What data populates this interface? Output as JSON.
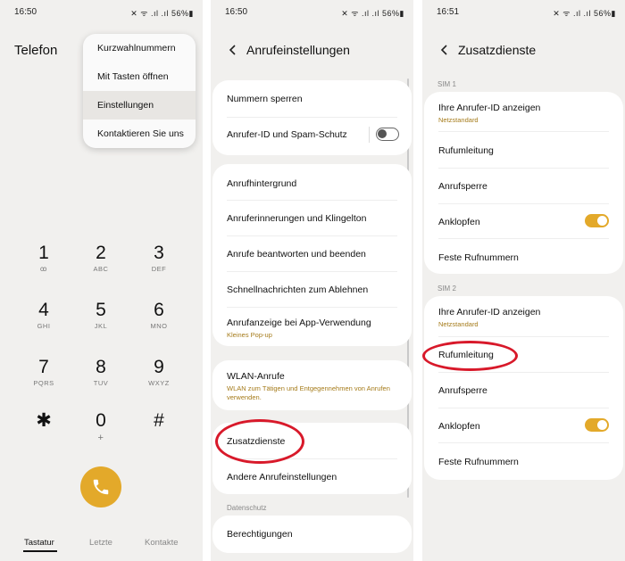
{
  "screen1": {
    "status": {
      "time": "16:50",
      "icons": "!! ≈ .∥ .∥ 56%▮",
      "battery": "56%"
    },
    "title": "Telefon",
    "menu": [
      {
        "label": "Kurzwahlnummern"
      },
      {
        "label": "Mit Tasten öffnen"
      },
      {
        "label": "Einstellungen"
      },
      {
        "label": "Kontaktieren Sie uns"
      }
    ],
    "keys": [
      {
        "digit": "1",
        "letters": "ꝏ"
      },
      {
        "digit": "2",
        "letters": "ABC"
      },
      {
        "digit": "3",
        "letters": "DEF"
      },
      {
        "digit": "4",
        "letters": "GHI"
      },
      {
        "digit": "5",
        "letters": "JKL"
      },
      {
        "digit": "6",
        "letters": "MNO"
      },
      {
        "digit": "7",
        "letters": "PQRS"
      },
      {
        "digit": "8",
        "letters": "TUV"
      },
      {
        "digit": "9",
        "letters": "WXYZ"
      },
      {
        "digit": "*",
        "letters": ""
      },
      {
        "digit": "0",
        "letters": "+"
      },
      {
        "digit": "#",
        "letters": ""
      }
    ],
    "tabs": [
      {
        "label": "Tastatur"
      },
      {
        "label": "Letzte"
      },
      {
        "label": "Kontakte"
      }
    ],
    "accent": "#e3a92a"
  },
  "screen2": {
    "status": {
      "time": "16:50",
      "battery": "56%"
    },
    "title": "Anrufeinstellungen",
    "rows": [
      {
        "label": "Nummern sperren"
      },
      {
        "label": "Anrufer-ID und Spam-Schutz",
        "toggle": false
      },
      {
        "label": "Anrufhintergrund"
      },
      {
        "label": "Anruferinnerungen und Klingelton"
      },
      {
        "label": "Anrufe beantworten und beenden"
      },
      {
        "label": "Schnellnachrichten zum Ablehnen"
      },
      {
        "label": "Anrufanzeige bei App-Verwendung",
        "sub": "Kleines Pop-up"
      },
      {
        "label": "WLAN-Anrufe",
        "sub": "WLAN zum Tätigen und Entgegennehmen von Anrufen verwenden."
      },
      {
        "label": "Zusatzdienste"
      },
      {
        "label": "Andere Anrufeinstellungen"
      },
      {
        "label": "Berechtigungen"
      }
    ],
    "section_privacy": "Datenschutz"
  },
  "screen3": {
    "status": {
      "time": "16:51",
      "battery": "56%"
    },
    "title": "Zusatzdienste",
    "sim1": {
      "label": "SIM 1",
      "rows": [
        {
          "label": "Ihre Anrufer-ID anzeigen",
          "sub": "Netzstandard"
        },
        {
          "label": "Rufumleitung"
        },
        {
          "label": "Anrufsperre"
        },
        {
          "label": "Anklopfen",
          "toggle": true
        },
        {
          "label": "Feste Rufnummern"
        }
      ]
    },
    "sim2": {
      "label": "SIM 2",
      "rows": [
        {
          "label": "Ihre Anrufer-ID anzeigen",
          "sub": "Netzstandard"
        },
        {
          "label": "Rufumleitung"
        },
        {
          "label": "Anrufsperre"
        },
        {
          "label": "Anklopfen",
          "toggle": true
        },
        {
          "label": "Feste Rufnummern"
        }
      ]
    }
  },
  "colors": {
    "accent": "#e3a92a",
    "highlight": "#d8192a",
    "subtext": "#a57b1a"
  }
}
